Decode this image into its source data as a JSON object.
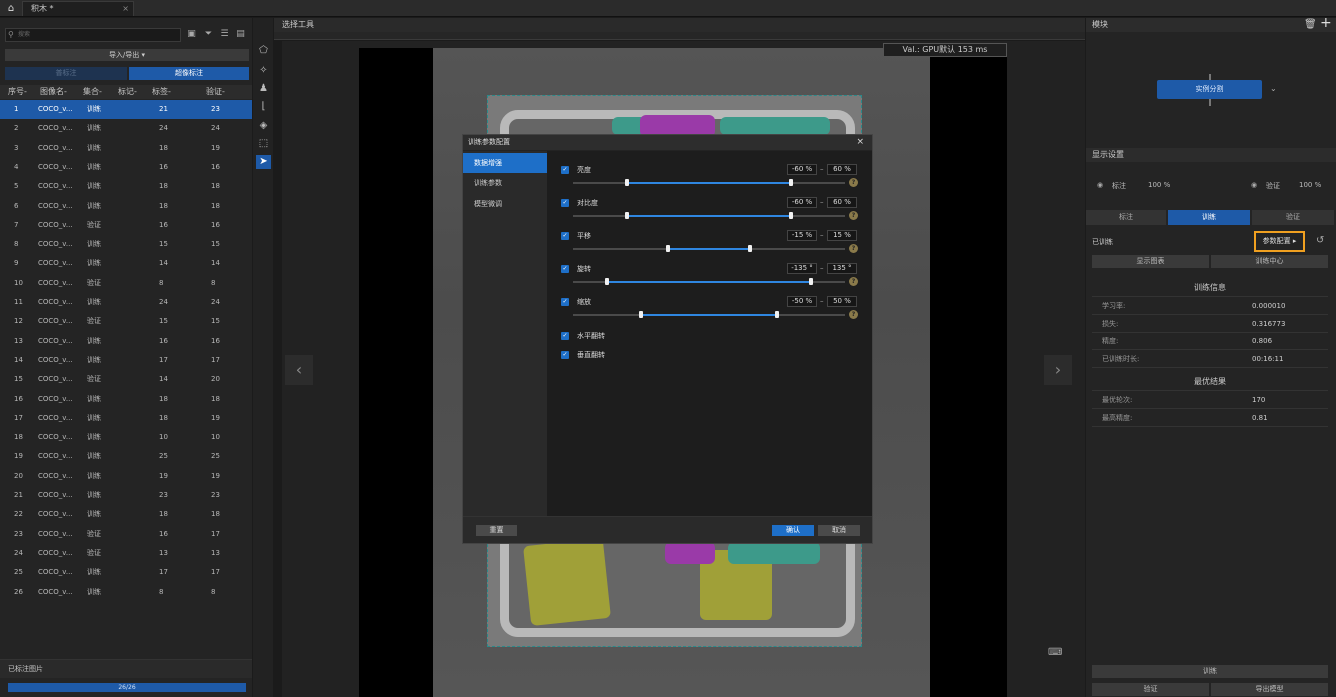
{
  "tab": {
    "title": "积木 *",
    "close": "×"
  },
  "left": {
    "search_placeholder": "搜索",
    "import_export": "导入/导出 ▾",
    "btn_normal": "普标注",
    "btn_super": "超像标注",
    "columns": [
      "序号-",
      "图像名-",
      "集合-",
      "标记-",
      "标签-",
      "验证-"
    ],
    "rows": [
      [
        "1",
        "COCO_v...",
        "训练",
        "",
        "21",
        "23"
      ],
      [
        "2",
        "COCO_v...",
        "训练",
        "",
        "24",
        "24"
      ],
      [
        "3",
        "COCO_v...",
        "训练",
        "",
        "18",
        "19"
      ],
      [
        "4",
        "COCO_v...",
        "训练",
        "",
        "16",
        "16"
      ],
      [
        "5",
        "COCO_v...",
        "训练",
        "",
        "18",
        "18"
      ],
      [
        "6",
        "COCO_v...",
        "训练",
        "",
        "18",
        "18"
      ],
      [
        "7",
        "COCO_v...",
        "验证",
        "",
        "16",
        "16"
      ],
      [
        "8",
        "COCO_v...",
        "训练",
        "",
        "15",
        "15"
      ],
      [
        "9",
        "COCO_v...",
        "训练",
        "",
        "14",
        "14"
      ],
      [
        "10",
        "COCO_v...",
        "验证",
        "",
        "8",
        "8"
      ],
      [
        "11",
        "COCO_v...",
        "训练",
        "",
        "24",
        "24"
      ],
      [
        "12",
        "COCO_v...",
        "验证",
        "",
        "15",
        "15"
      ],
      [
        "13",
        "COCO_v...",
        "训练",
        "",
        "16",
        "16"
      ],
      [
        "14",
        "COCO_v...",
        "训练",
        "",
        "17",
        "17"
      ],
      [
        "15",
        "COCO_v...",
        "验证",
        "",
        "14",
        "20"
      ],
      [
        "16",
        "COCO_v...",
        "训练",
        "",
        "18",
        "18"
      ],
      [
        "17",
        "COCO_v...",
        "训练",
        "",
        "18",
        "19"
      ],
      [
        "18",
        "COCO_v...",
        "训练",
        "",
        "10",
        "10"
      ],
      [
        "19",
        "COCO_v...",
        "训练",
        "",
        "25",
        "25"
      ],
      [
        "20",
        "COCO_v...",
        "训练",
        "",
        "19",
        "19"
      ],
      [
        "21",
        "COCO_v...",
        "训练",
        "",
        "23",
        "23"
      ],
      [
        "22",
        "COCO_v...",
        "训练",
        "",
        "18",
        "18"
      ],
      [
        "23",
        "COCO_v...",
        "验证",
        "",
        "16",
        "17"
      ],
      [
        "24",
        "COCO_v...",
        "验证",
        "",
        "13",
        "13"
      ],
      [
        "25",
        "COCO_v...",
        "训练",
        "",
        "17",
        "17"
      ],
      [
        "26",
        "COCO_v...",
        "训练",
        "",
        "8",
        "8"
      ]
    ],
    "labeled_title": "已标注图片",
    "progress_text": "26/26",
    "progress_fraction": 1.0
  },
  "canvas": {
    "header": "选择工具",
    "badge": "Val.: GPU默认 153 ms",
    "prev": "‹",
    "next": "›"
  },
  "right": {
    "module_title": "模块",
    "seg_button": "实例分割",
    "display_title": "显示设置",
    "label_vis": "标注",
    "label_pct": "100 %",
    "val_vis": "验证",
    "val_pct": "100 %",
    "tabs": [
      "标注",
      "训练",
      "验证"
    ],
    "trained_label": "已训练",
    "param_btn": "参数配置 ▸",
    "show_chart": "显示图表",
    "train_center": "训练中心",
    "train_info_title": "训练信息",
    "train_info": [
      {
        "k": "学习率:",
        "v": "0.000010"
      },
      {
        "k": "损失:",
        "v": "0.316773"
      },
      {
        "k": "精度:",
        "v": "0.806"
      },
      {
        "k": "已训练时长:",
        "v": "00:16:11"
      }
    ],
    "best_title": "最优结果",
    "best": [
      {
        "k": "最优轮次:",
        "v": "170"
      },
      {
        "k": "最高精度:",
        "v": "0.81"
      }
    ],
    "train_btn": "训练",
    "verify_btn": "验证",
    "export_btn": "导出模型"
  },
  "dialog": {
    "title": "训练参数配置",
    "close": "×",
    "nav": [
      "数据增强",
      "训练参数",
      "模型微调"
    ],
    "params": [
      {
        "label": "亮度",
        "min": "-60 %",
        "max": "60 %",
        "lo": 0.2,
        "hi": 0.8
      },
      {
        "label": "对比度",
        "min": "-60 %",
        "max": "60 %",
        "lo": 0.2,
        "hi": 0.8
      },
      {
        "label": "平移",
        "min": "-15 %",
        "max": "15 %",
        "lo": 0.35,
        "hi": 0.65
      },
      {
        "label": "旋转",
        "min": "-135 °",
        "max": "135 °",
        "lo": 0.125,
        "hi": 0.875
      },
      {
        "label": "缩放",
        "min": "-50 %",
        "max": "50 %",
        "lo": 0.25,
        "hi": 0.75
      }
    ],
    "flip_h": "水平翻转",
    "flip_v": "垂直翻转",
    "reset": "重置",
    "ok": "确认",
    "cancel": "取消"
  }
}
